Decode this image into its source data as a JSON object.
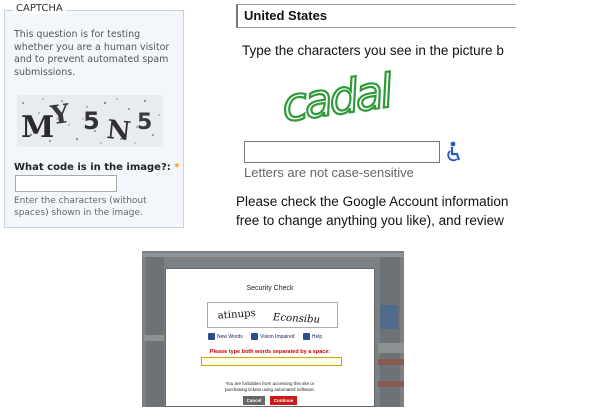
{
  "drupal": {
    "legend": "CAPTCHA",
    "description": "This question is for testing whether you are a human visitor and to prevent automated spam submissions.",
    "captcha_chars": [
      "M",
      "Y",
      "5",
      "N",
      "5"
    ],
    "question": "What code is in the image?:",
    "required_mark": "*",
    "input_value": "",
    "help": "Enter the characters (without spaces) shown in the image."
  },
  "google": {
    "country": "United States",
    "prompt": "Type the characters you see in the picture b",
    "captcha_word": "cadal",
    "input_value": "",
    "case_note": "Letters are not case-sensitive",
    "paragraph_line1": "Please check the Google Account information",
    "paragraph_line2": "free to change anything you like), and review",
    "accessibility_icon": "wheelchair-icon"
  },
  "tickets": {
    "title": "Security Check",
    "word1": "atinups",
    "word2": "Econsibu",
    "new_words": "New Words",
    "vision_impaired": "Vision Impaired",
    "help": "Help",
    "instruction": "Please type both words separated by a space:",
    "input_value": "",
    "warning_line1": "You are forbidden from accessing this site or",
    "warning_line2": "purchasing tickets using automated software.",
    "cancel": "Cancel",
    "continue": "Continue"
  },
  "colors": {
    "google_captcha_green": "#2e9a3a",
    "ticket_red": "#cc0000",
    "drupal_required": "#f0a000"
  }
}
